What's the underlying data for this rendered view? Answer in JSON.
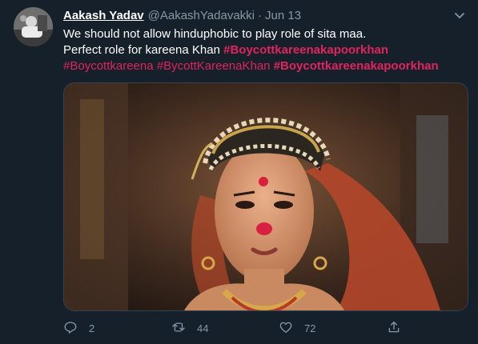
{
  "author": {
    "name": "Aakash Yadav",
    "handle": "@AakashYadavakki",
    "separator": "·",
    "date": "Jun 13"
  },
  "tweet": {
    "line1": "We should not allow hinduphobic to play role of sita maa.",
    "line2_prefix": "Perfect role for kareena Khan ",
    "hashtags": [
      "#Boycottkareenakapoorkhan",
      "#Boycottkareena",
      "#BycottKareenaKhan",
      "#Boycottkareenakapoorkhan"
    ]
  },
  "actions": {
    "replies": "2",
    "retweets": "44",
    "likes": "72"
  },
  "colors": {
    "background": "#15202b",
    "secondary_text": "#8899a6",
    "hashtag": "#e0245e"
  },
  "icons": [
    "caret-down-icon",
    "reply-icon",
    "retweet-icon",
    "like-icon",
    "share-icon"
  ]
}
